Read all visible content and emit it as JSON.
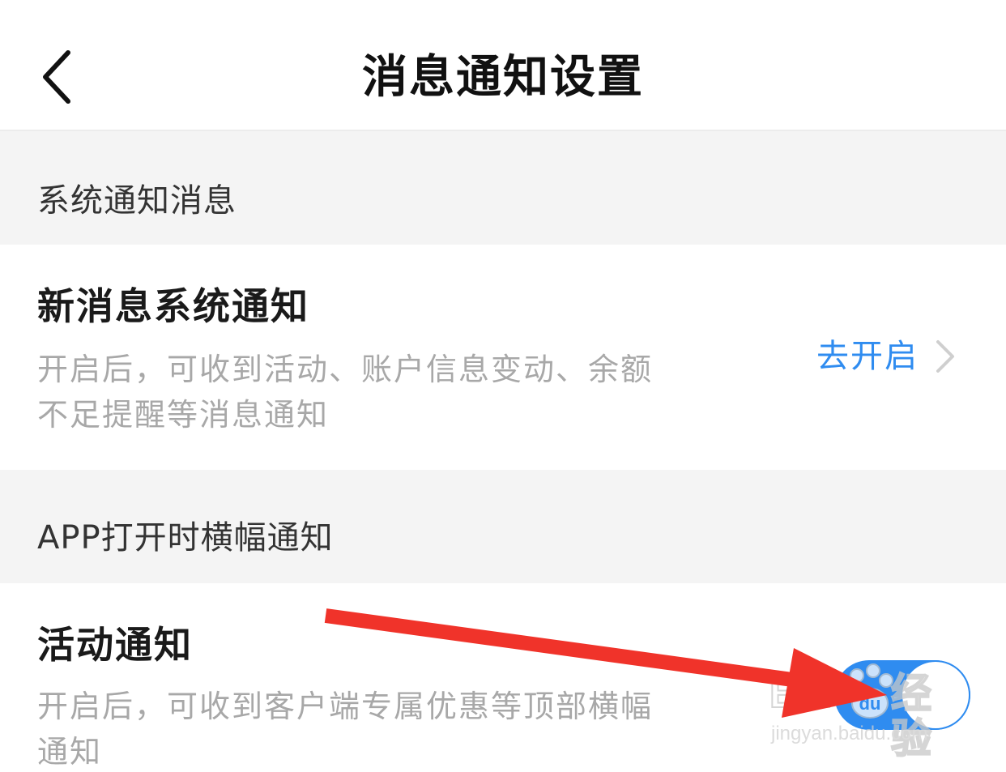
{
  "navbar": {
    "title": "消息通知设置",
    "back_icon": "chevron-left-icon"
  },
  "sections": [
    {
      "header": "系统通知消息",
      "row": {
        "title": "新消息系统通知",
        "desc_line1": "开启后，可收到活动、账户信息变动、余额",
        "desc_line2": "不足提醒等消息通知",
        "action_label": "去开启",
        "action_icon": "chevron-right-icon"
      }
    },
    {
      "header": "APP打开时横幅通知",
      "row": {
        "title": "活动通知",
        "desc_line1": "开启后，可收到客户端专属优惠等顶部横幅",
        "desc_line2": "通知",
        "toggle_on": true
      }
    }
  ],
  "annotation": {
    "arrow_color": "#f0332a"
  },
  "watermark": {
    "brand_left": "Bai",
    "brand_right": "经验",
    "url": "jingyan.baidu.com"
  },
  "colors": {
    "accent": "#2f8cf0",
    "section_bg": "#f4f4f4",
    "desc_text": "#a8a8a8"
  }
}
